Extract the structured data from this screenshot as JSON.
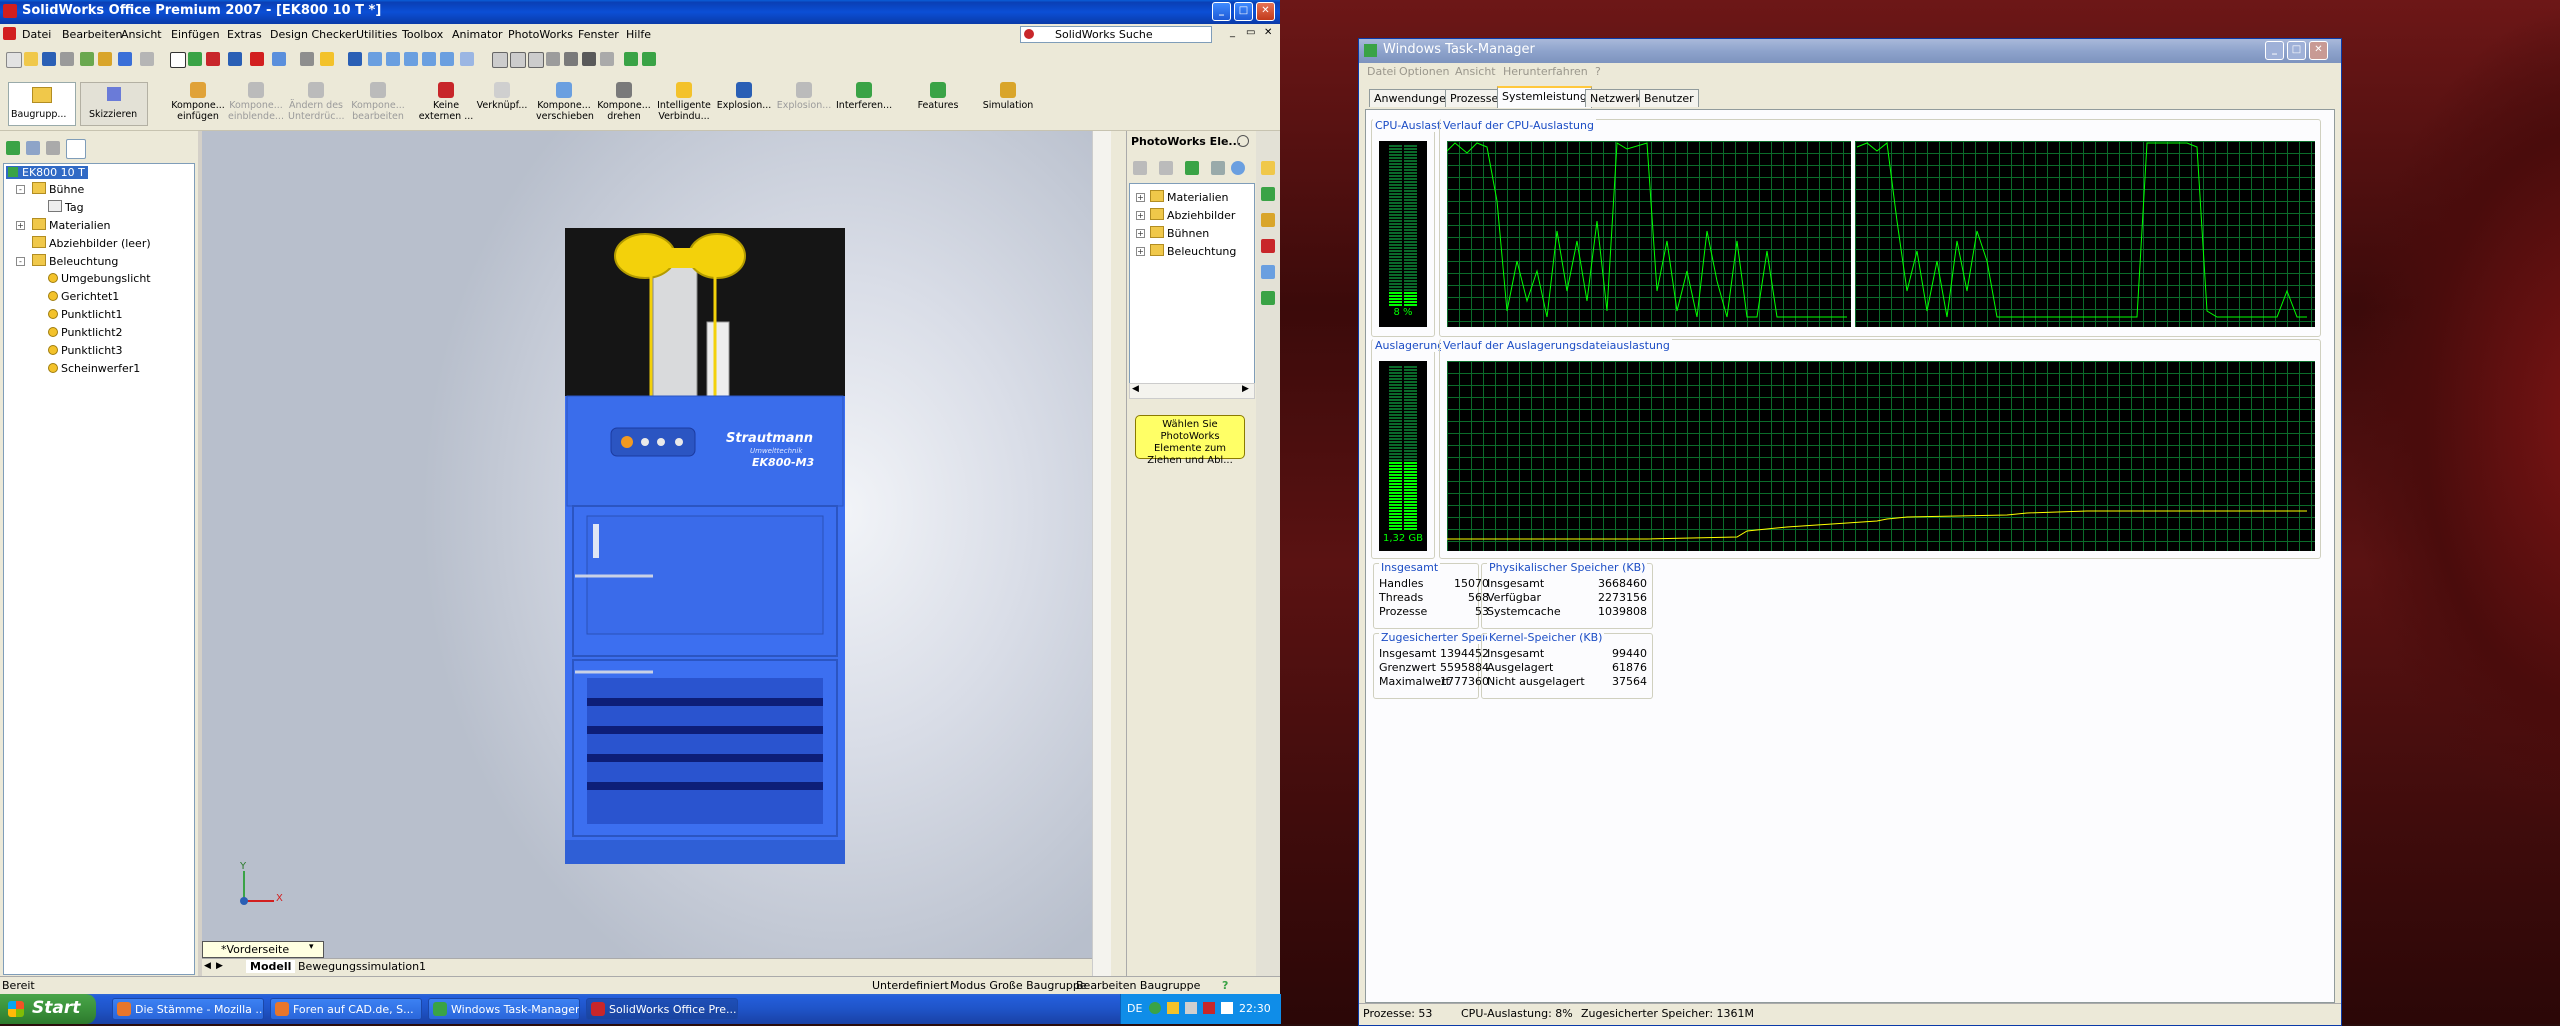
{
  "colors": {
    "xp_blue": "#0b4fd6",
    "tm_graph": "#00ff00",
    "tm_grid": "#0b6b2a",
    "machine_blue": "#3c6ff0",
    "yellow": "#f3c22b"
  },
  "solidworks": {
    "title": "SolidWorks Office Premium 2007 - [EK800 10 T *]",
    "search_label": "SolidWorks Suche",
    "menu": [
      "Datei",
      "Bearbeiten",
      "Ansicht",
      "Einfügen",
      "Extras",
      "Design Checker",
      "Utilities",
      "Toolbox",
      "Animator",
      "PhotoWorks",
      "Fenster",
      "Hilfe"
    ],
    "command_tabs": [
      {
        "label": "Baugrupp...",
        "enabled": true
      },
      {
        "label": "Skizzieren",
        "enabled": true
      }
    ],
    "commands": [
      {
        "label": "Kompone...\neinfügen",
        "enabled": true
      },
      {
        "label": "Kompone...\neinblende...",
        "enabled": false
      },
      {
        "label": "Ändern des\nUnterdrüc...",
        "enabled": false
      },
      {
        "label": "Kompone...\nbearbeiten",
        "enabled": false
      },
      {
        "label": "Keine\nexternen ...",
        "enabled": true
      },
      {
        "label": "Verknüpf...",
        "enabled": true
      },
      {
        "label": "Kompone...\nverschieben",
        "enabled": true
      },
      {
        "label": "Kompone...\ndrehen",
        "enabled": true
      },
      {
        "label": "Intelligente\nVerbindu...",
        "enabled": true
      },
      {
        "label": "Explosion...",
        "enabled": true
      },
      {
        "label": "Explosion...",
        "enabled": false
      },
      {
        "label": "Interferen...",
        "enabled": true
      },
      {
        "label": "Features",
        "enabled": true
      },
      {
        "label": "Simulation",
        "enabled": true
      }
    ],
    "tree": {
      "root": "EK800 10 T",
      "items": [
        {
          "label": "Bühne",
          "level": 1,
          "icon": "folder-icon",
          "expand": "-"
        },
        {
          "label": "Tag",
          "level": 2,
          "icon": "image-icon",
          "expand": ""
        },
        {
          "label": "Materialien",
          "level": 1,
          "icon": "folder-icon",
          "expand": "+"
        },
        {
          "label": "Abziehbilder (leer)",
          "level": 1,
          "icon": "folder-icon",
          "expand": ""
        },
        {
          "label": "Beleuchtung",
          "level": 1,
          "icon": "folder-icon",
          "expand": "-"
        },
        {
          "label": "Umgebungslicht",
          "level": 2,
          "icon": "lamp-icon",
          "expand": ""
        },
        {
          "label": "Gerichtet1",
          "level": 2,
          "icon": "lamp-icon",
          "expand": ""
        },
        {
          "label": "Punktlicht1",
          "level": 2,
          "icon": "lamp-icon",
          "expand": ""
        },
        {
          "label": "Punktlicht2",
          "level": 2,
          "icon": "lamp-icon",
          "expand": ""
        },
        {
          "label": "Punktlicht3",
          "level": 2,
          "icon": "lamp-icon",
          "expand": ""
        },
        {
          "label": "Scheinwerfer1",
          "level": 2,
          "icon": "lamp-icon",
          "expand": ""
        }
      ]
    },
    "machine": {
      "brand": "Strautmann",
      "sub": "Umwelttechnik",
      "model": "EK800-M3"
    },
    "triad": {
      "x": "X",
      "y": "Y"
    },
    "view_dropdown": "*Vorderseite",
    "model_tabs": [
      "Modell",
      "Bewegungssimulation1"
    ],
    "photoworks": {
      "title": "PhotoWorks Ele...",
      "items": [
        "Materialien",
        "Abziehbilder",
        "Bühnen",
        "Beleuchtung"
      ],
      "hint": "Wählen Sie PhotoWorks Elemente zum Ziehen und Abl..."
    },
    "status": {
      "left": "Bereit",
      "center": [
        "Unterdefiniert",
        "Modus Große Baugruppe",
        "Bearbeiten Baugruppe"
      ],
      "help": "?"
    }
  },
  "taskmanager": {
    "title": "Windows Task-Manager",
    "menu": [
      "Datei",
      "Optionen",
      "Ansicht",
      "Herunterfahren",
      "?"
    ],
    "tabs": [
      "Anwendungen",
      "Prozesse",
      "Systemleistung",
      "Netzwerk",
      "Benutzer"
    ],
    "active_tab": 2,
    "cpu": {
      "label": "CPU-Auslastung",
      "value": "8 %",
      "fraction": 0.08,
      "history_label": "Verlauf der CPU-Auslastung"
    },
    "pagefile": {
      "label": "Auslagerungsdatei",
      "value": "1,32 GB",
      "fraction": 0.36,
      "history_label": "Verlauf der Auslagerungsdateiauslastung"
    },
    "totals": {
      "title": "Insgesamt",
      "rows": [
        [
          "Handles",
          "15070"
        ],
        [
          "Threads",
          "568"
        ],
        [
          "Prozesse",
          "53"
        ]
      ]
    },
    "physical": {
      "title": "Physikalischer Speicher (KB)",
      "rows": [
        [
          "Insgesamt",
          "3668460"
        ],
        [
          "Verfügbar",
          "2273156"
        ],
        [
          "Systemcache",
          "1039808"
        ]
      ]
    },
    "commit": {
      "title": "Zugesicherter Speicher (KB)",
      "rows": [
        [
          "Insgesamt",
          "1394452"
        ],
        [
          "Grenzwert",
          "5595884"
        ],
        [
          "Maximalwert",
          "1777360"
        ]
      ]
    },
    "kernel": {
      "title": "Kernel-Speicher (KB)",
      "rows": [
        [
          "Insgesamt",
          "99440"
        ],
        [
          "Ausgelagert",
          "61876"
        ],
        [
          "Nicht ausgelagert",
          "37564"
        ]
      ]
    },
    "statusbar": [
      "Prozesse: 53",
      "CPU-Auslastung: 8%",
      "Zugesicherter Speicher: 1361M"
    ]
  },
  "taskbar": {
    "start": "Start",
    "buttons": [
      {
        "label": "Die Stämme - Mozilla ...",
        "color": "#e8762b"
      },
      {
        "label": "Foren auf CAD.de, S...",
        "color": "#e8762b"
      },
      {
        "label": "Windows Task-Manager",
        "color": "#3aa346"
      },
      {
        "label": "SolidWorks Office Pre...",
        "color": "#c8262a"
      }
    ],
    "lang": "DE",
    "clock": "22:30"
  }
}
